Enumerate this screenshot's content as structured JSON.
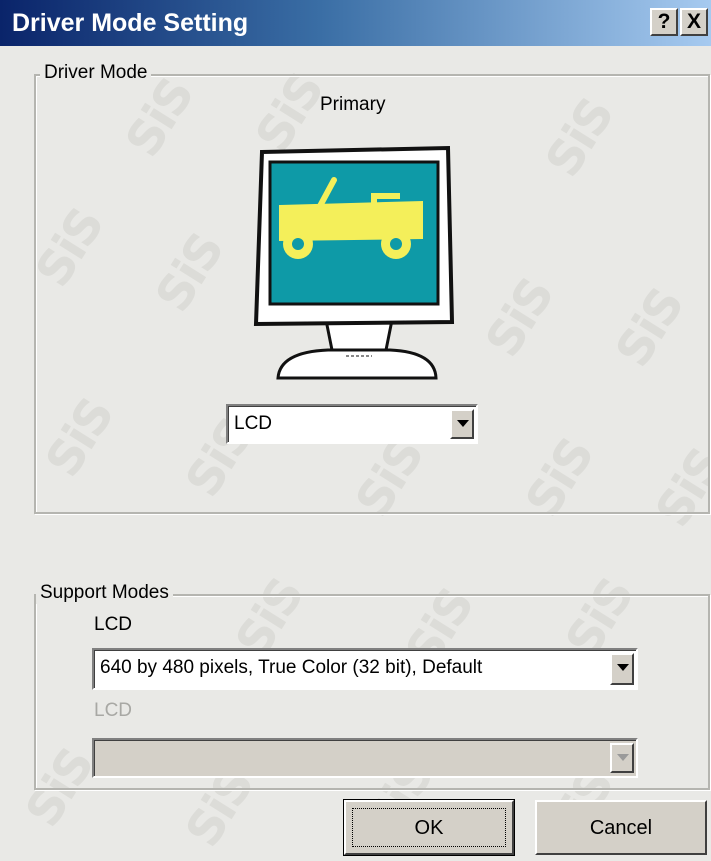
{
  "window": {
    "title": "Driver Mode Setting"
  },
  "titlebar_buttons": {
    "help": "?",
    "close": "X"
  },
  "watermark": "SiS",
  "driver_mode": {
    "group_label": "Driver Mode",
    "display_label": "Primary",
    "device_select": {
      "value": "LCD"
    }
  },
  "support_modes": {
    "group_label": "Support Modes",
    "primary_label": "LCD",
    "primary_select": {
      "value": "640 by 480 pixels, True Color (32 bit), Default"
    },
    "secondary_label": "LCD",
    "secondary_select": {
      "value": ""
    }
  },
  "buttons": {
    "ok": "OK",
    "cancel": "Cancel"
  },
  "colors": {
    "title_gradient_start": "#0a246a",
    "title_gradient_end": "#a6caf0",
    "dialog_bg": "#e9e9e6",
    "screen_teal": "#0e9aa7",
    "jeep_yellow": "#f4ef5a"
  },
  "icons": {
    "display": "monitor-with-jeep-icon"
  }
}
